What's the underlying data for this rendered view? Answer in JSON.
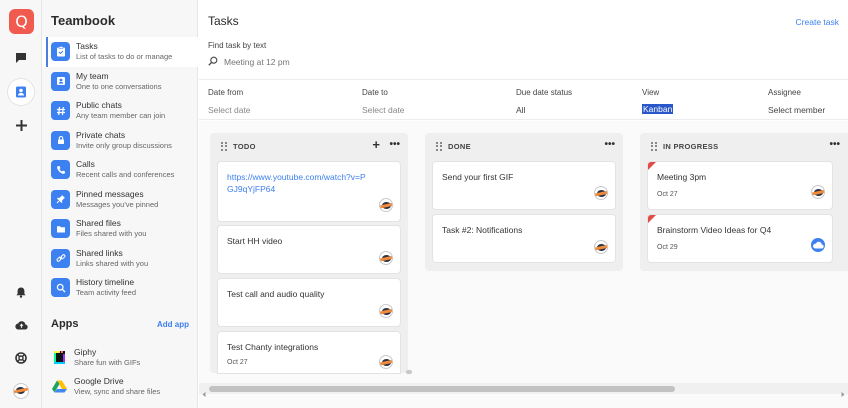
{
  "app": {
    "logo_letter": "Q",
    "brand": "Teambook",
    "accent": "#3d80f0",
    "logo_color": "#f05a4f"
  },
  "rail": {
    "icons": [
      "chat-icon",
      "contacts-icon",
      "plus-icon",
      "bell-icon",
      "cloud-upload-icon",
      "help-icon",
      "avatar"
    ]
  },
  "sidebar": {
    "items": [
      {
        "title": "Tasks",
        "subtitle": "List of tasks to do or manage",
        "icon": "tasks-icon"
      },
      {
        "title": "My team",
        "subtitle": "One to one conversations",
        "icon": "team-icon"
      },
      {
        "title": "Public chats",
        "subtitle": "Any team member can join",
        "icon": "hash-icon"
      },
      {
        "title": "Private chats",
        "subtitle": "Invite only group discussions",
        "icon": "lock-icon"
      },
      {
        "title": "Calls",
        "subtitle": "Recent calls and conferences",
        "icon": "phone-icon"
      },
      {
        "title": "Pinned messages",
        "subtitle": "Messages you've pinned",
        "icon": "pin-icon"
      },
      {
        "title": "Shared files",
        "subtitle": "Files shared with you",
        "icon": "folder-icon"
      },
      {
        "title": "Shared links",
        "subtitle": "Links shared with you",
        "icon": "link-icon"
      },
      {
        "title": "History timeline",
        "subtitle": "Team activity feed",
        "icon": "search-history-icon"
      }
    ],
    "apps_heading": "Apps",
    "add_app": "Add app",
    "apps": [
      {
        "title": "Giphy",
        "subtitle": "Share fun with GIFs",
        "icon": "giphy-icon"
      },
      {
        "title": "Google Drive",
        "subtitle": "View, sync and share files",
        "icon": "google-drive-icon"
      }
    ]
  },
  "main": {
    "title": "Tasks",
    "create_task": "Create task",
    "find_label": "Find task by text",
    "find_placeholder": "Meeting at 12 pm",
    "filters": [
      {
        "label": "Date from",
        "value": "Select date"
      },
      {
        "label": "Date to",
        "value": "Select date"
      },
      {
        "label": "Due date status",
        "value": "All"
      },
      {
        "label": "View",
        "value": "Kanban"
      },
      {
        "label": "Assignee",
        "value": "Select member"
      }
    ]
  },
  "board": {
    "columns": [
      {
        "title": "TODO",
        "cards": [
          {
            "text": "https://www.youtube.com/watch?v=PGJ9qYjFP64",
            "date": ""
          },
          {
            "text": "Start HH video",
            "date": ""
          },
          {
            "text": "Test call and audio quality",
            "date": ""
          },
          {
            "text": "Test Chanty integrations",
            "date": "Oct 27"
          }
        ]
      },
      {
        "title": "DONE",
        "cards": [
          {
            "text": "Send your first GIF",
            "date": ""
          },
          {
            "text": "Task #2: Notifications",
            "date": ""
          }
        ]
      },
      {
        "title": "IN PROGRESS",
        "cards": [
          {
            "text": "Meeting 3pm",
            "date": "Oct 27"
          },
          {
            "text": "Brainstorm Video Ideas for Q4",
            "date": "Oct 29"
          }
        ]
      }
    ]
  }
}
